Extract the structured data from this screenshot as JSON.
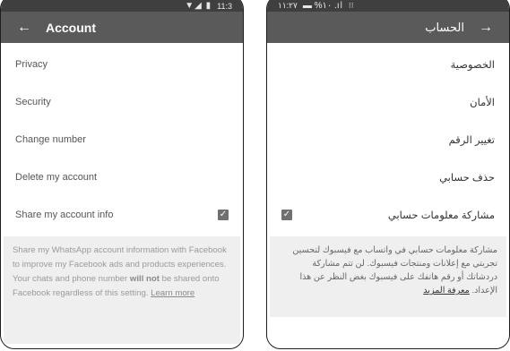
{
  "left": {
    "status": {
      "icons": "▼◢ ▮",
      "time": "11:3"
    },
    "appbar": {
      "back_icon": "arrow-left-icon",
      "title": "Account"
    },
    "items": [
      {
        "label": "Privacy"
      },
      {
        "label": "Security"
      },
      {
        "label": "Change number"
      },
      {
        "label": "Delete my account"
      },
      {
        "label": "Share my account info",
        "checked": true
      }
    ],
    "info": {
      "text_before": "Share my WhatsApp account information with Facebook to improve my Facebook ads and products experiences. Your chats and phone number ",
      "bold": "will not",
      "text_after": " be shared onto Facebook regardless of this setting. ",
      "link": "Learn more"
    }
  },
  "right": {
    "status": {
      "time": "١١:٢٧",
      "icons": "▬ %١٠ .ıl",
      "extra": "⁝⁝"
    },
    "appbar": {
      "back_icon": "arrow-right-icon",
      "title": "الحساب"
    },
    "items": [
      {
        "label": "الخصوصية"
      },
      {
        "label": "الأمان"
      },
      {
        "label": "تغيير الرقم"
      },
      {
        "label": "حذف حسابي"
      },
      {
        "label": "مشاركة معلومات حسابي",
        "checked": true
      }
    ],
    "info": {
      "text": "مشاركة معلومات حسابي في واتساب مع فيسبوك لتحسين تجربتي مع إعلانات ومنتجات فيسبوك. لن تتم مشاركة دردشاتك أو رقم هاتفك على فيسبوك بغض النظر عن هذا الإعداد. ",
      "link": "معرفة المزيد"
    }
  }
}
